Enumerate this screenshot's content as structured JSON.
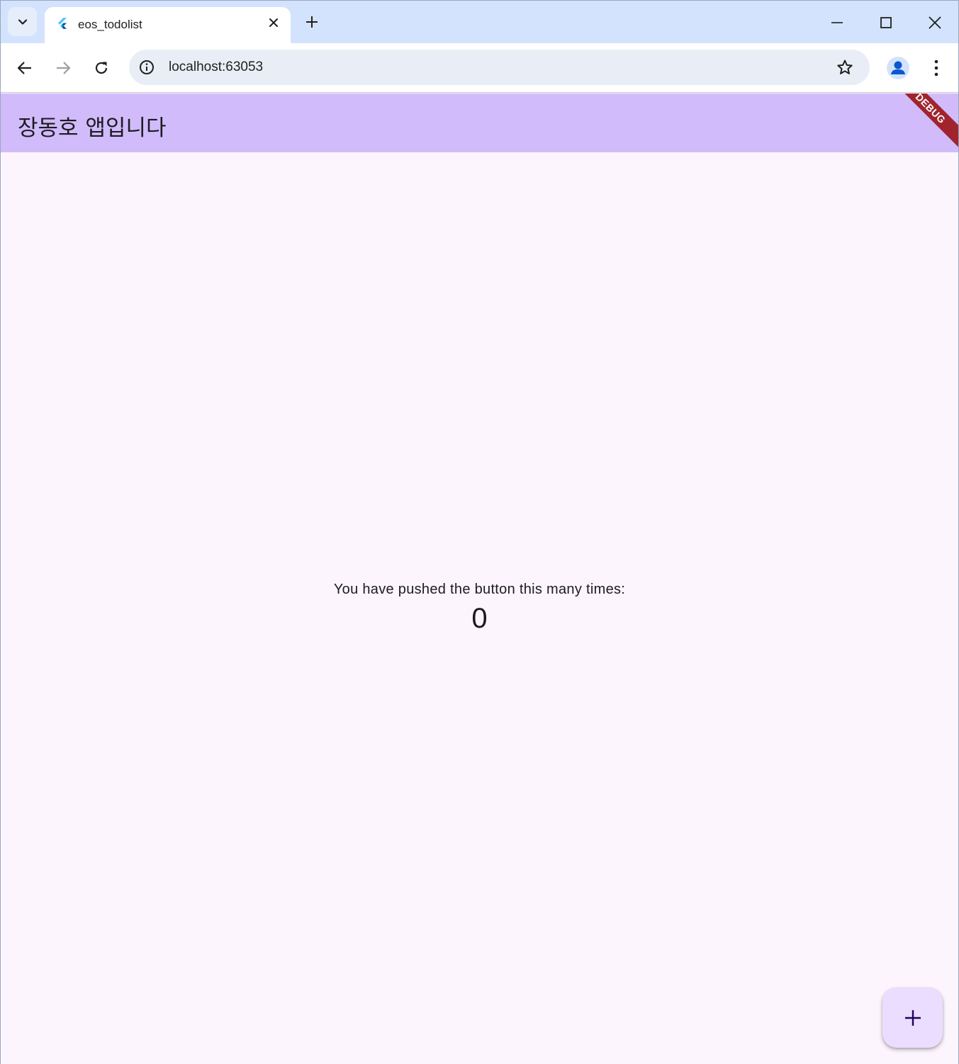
{
  "browser": {
    "tab": {
      "title": "eos_todolist"
    },
    "address_bar": {
      "url": "localhost:63053"
    }
  },
  "app": {
    "appbar_title": "장동호 앱입니다",
    "debug_banner": "DEBUG",
    "counter_label": "You have pushed the button this many times:",
    "counter_value": "0",
    "fab_icon": "add-icon"
  },
  "colors": {
    "tabstrip": "#d3e3fd",
    "appbar": "#d1bbfb",
    "background": "#fcf5fd",
    "fab": "#eaddff",
    "debug_banner": "#a0242e"
  }
}
